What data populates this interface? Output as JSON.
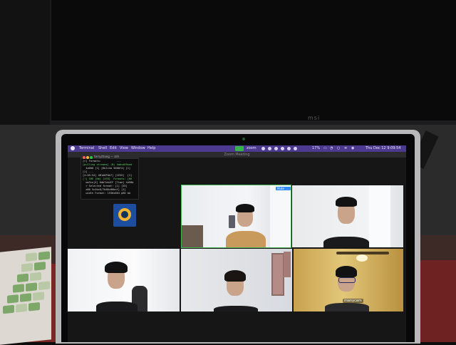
{
  "monitor": {
    "brand": "msi"
  },
  "menubar": {
    "items": [
      "Terminal",
      "Shell",
      "Edit",
      "View",
      "Window",
      "Help"
    ],
    "zoom_label": "zoom",
    "battery": "17%",
    "clock": "Thu Dec 12  9:09:54 PM"
  },
  "window": {
    "title": "Zoom Meeting"
  },
  "terminal": {
    "title": "terryzhang — zsh",
    "lines": [
      "[>] Formats:          ...",
      "[pulling streams] (N) 4abcd69ead",
      "  4a000 [1] [6b1c4a 5000f4] [1]",
      "[1] ...",
      "[4:05:54] 4B1A0F0A7] [1E55]  [1]",
      "[!] SHE [Hm] [4F8]  Formats: [66",
      "  mo3in[4] 6db7eb4CF [Time] tb90b",
      "  > Selected format: [1] [35]",
      "  a00 5c4bc0/7b80c00bnf] [1]",
      "  width Format: 1536x864 p60 bA"
    ]
  },
  "gallery": {
    "tile_badges": [
      "Mute",
      "..."
    ],
    "watermark": "manycam"
  },
  "colors": {
    "menubar": "#4b3a8f",
    "active_speaker": "#4ab456",
    "zoom_blue": "#2d8cff"
  }
}
